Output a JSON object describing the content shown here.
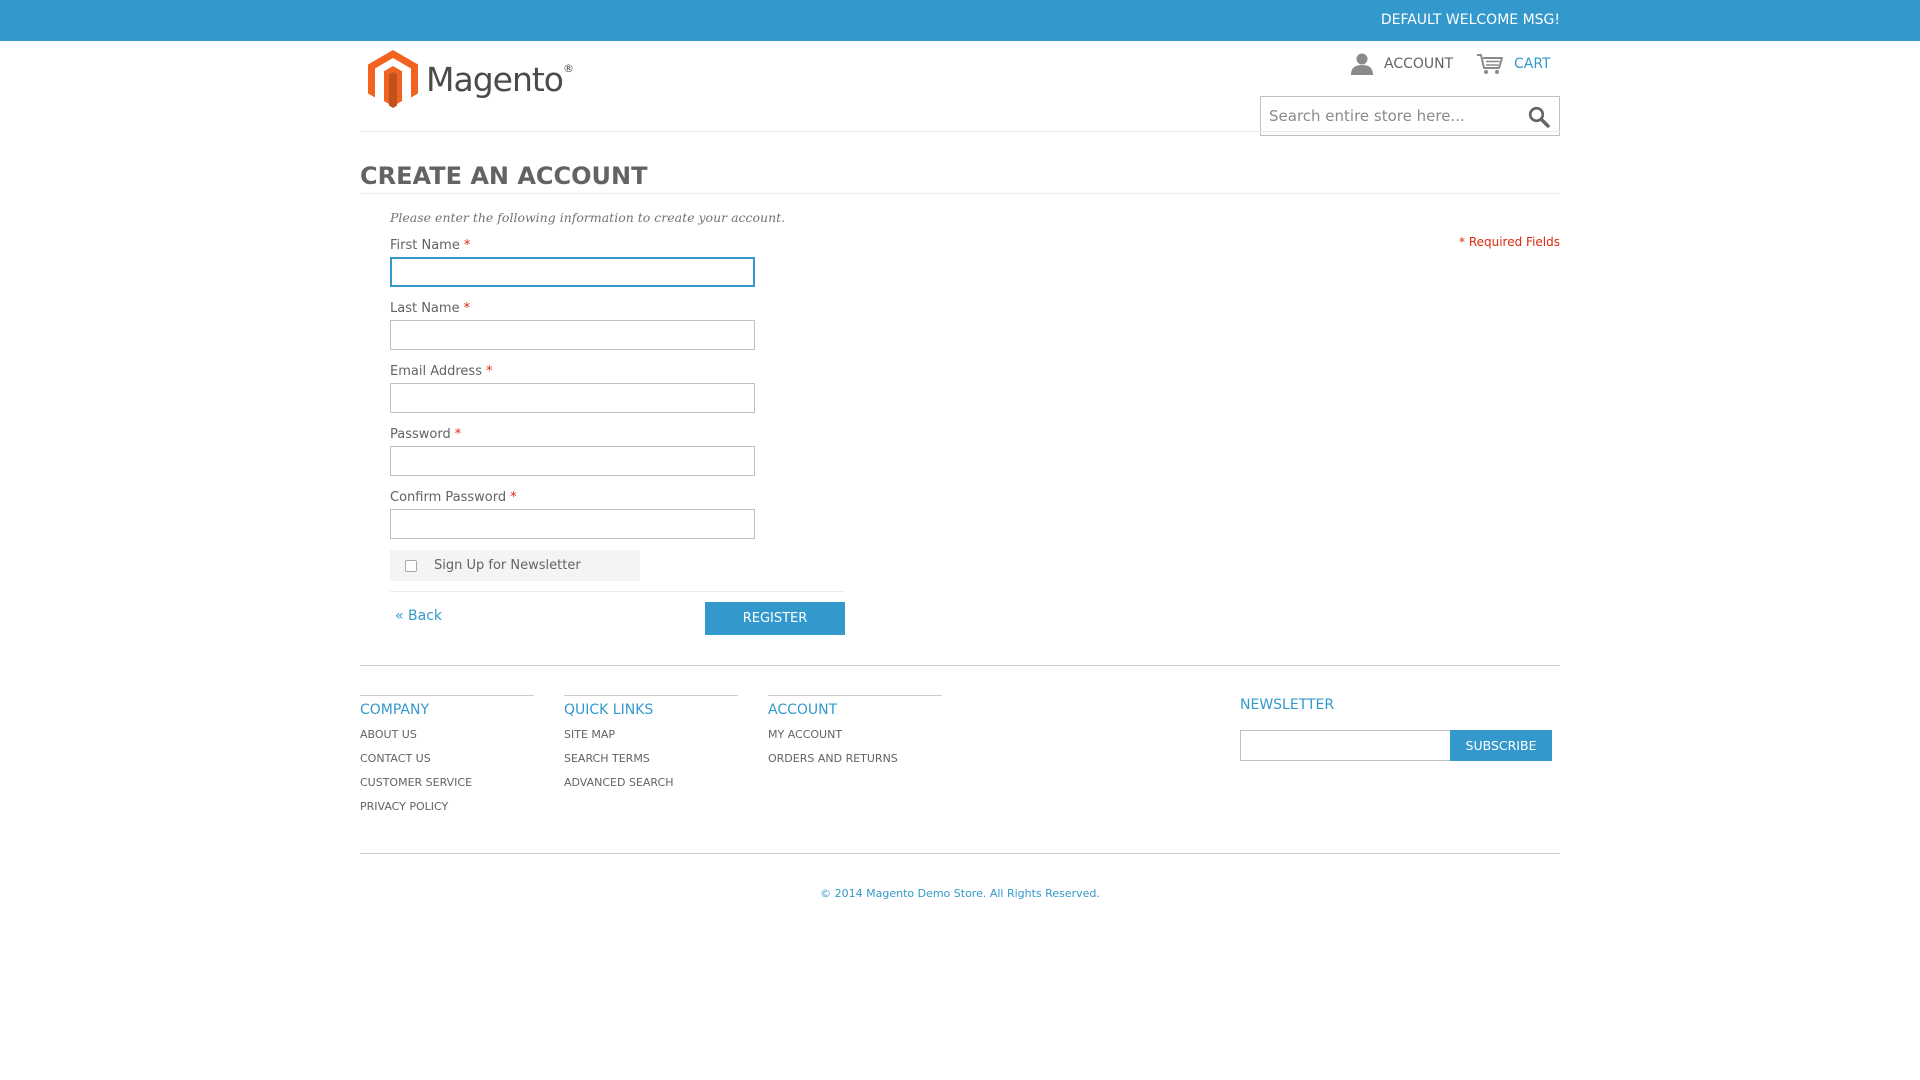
{
  "header": {
    "welcome": "DEFAULT WELCOME MSG!",
    "logo_text": "Magento",
    "logo_mark": "®",
    "account_label": "ACCOUNT",
    "cart_label": "CART",
    "search_placeholder": "Search entire store here...",
    "icons": {
      "account": "person-icon",
      "cart": "cart-icon",
      "search": "magnifier-icon"
    }
  },
  "page": {
    "title": "CREATE AN ACCOUNT",
    "intro": "Please enter the following information to create your account.",
    "required_note": "* Required Fields"
  },
  "form": {
    "fields": [
      {
        "label": "First Name",
        "required_mark": "*",
        "value": ""
      },
      {
        "label": "Last Name",
        "required_mark": "*",
        "value": ""
      },
      {
        "label": "Email Address",
        "required_mark": "*",
        "value": ""
      },
      {
        "label": "Password",
        "required_mark": "*",
        "value": ""
      },
      {
        "label": "Confirm Password",
        "required_mark": "*",
        "value": ""
      }
    ],
    "newsletter_label": "Sign Up for Newsletter",
    "newsletter_checked": false,
    "back_label": "« Back",
    "register_label": "REGISTER"
  },
  "footer": {
    "columns": [
      {
        "title": "COMPANY",
        "links": [
          "ABOUT US",
          "CONTACT US",
          "CUSTOMER SERVICE",
          "PRIVACY POLICY"
        ]
      },
      {
        "title": "QUICK LINKS",
        "links": [
          "SITE MAP",
          "SEARCH TERMS",
          "ADVANCED SEARCH"
        ]
      },
      {
        "title": "ACCOUNT",
        "links": [
          "MY ACCOUNT",
          "ORDERS AND RETURNS"
        ]
      }
    ],
    "newsletter_title": "NEWSLETTER",
    "subscribe_label": "SUBSCRIBE",
    "copyright": "© 2014 Magento Demo Store. All Rights Reserved."
  },
  "colors": {
    "accent": "#3399cc",
    "required": "#df280a",
    "text": "#636363",
    "orange_logo": "#f26322"
  }
}
